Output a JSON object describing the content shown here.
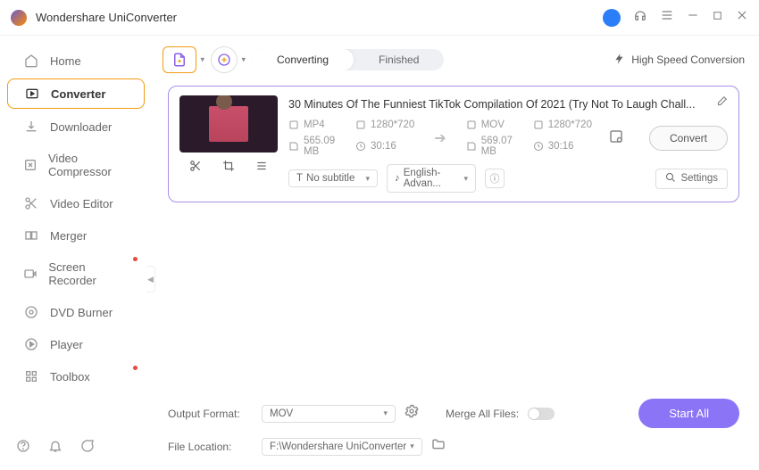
{
  "app": {
    "title": "Wondershare UniConverter"
  },
  "sidebar": {
    "items": [
      {
        "label": "Home"
      },
      {
        "label": "Converter"
      },
      {
        "label": "Downloader"
      },
      {
        "label": "Video Compressor"
      },
      {
        "label": "Video Editor"
      },
      {
        "label": "Merger"
      },
      {
        "label": "Screen Recorder"
      },
      {
        "label": "DVD Burner"
      },
      {
        "label": "Player"
      },
      {
        "label": "Toolbox"
      }
    ]
  },
  "tabs": {
    "converting": "Converting",
    "finished": "Finished"
  },
  "toolbar": {
    "highSpeed": "High Speed Conversion"
  },
  "file": {
    "title": "30 Minutes Of The Funniest TikTok Compilation Of 2021 (Try Not To Laugh Chall...",
    "input": {
      "format": "MP4",
      "resolution": "1280*720",
      "size": "565.09 MB",
      "duration": "30:16"
    },
    "output": {
      "format": "MOV",
      "resolution": "1280*720",
      "size": "569.07 MB",
      "duration": "30:16"
    },
    "subtitle": "No subtitle",
    "audio": "English-Advan...",
    "settings": "Settings",
    "convert": "Convert"
  },
  "footer": {
    "outputFormatLabel": "Output Format:",
    "outputFormat": "MOV",
    "fileLocationLabel": "File Location:",
    "fileLocation": "F:\\Wondershare UniConverter",
    "mergeLabel": "Merge All Files:",
    "startAll": "Start All"
  }
}
